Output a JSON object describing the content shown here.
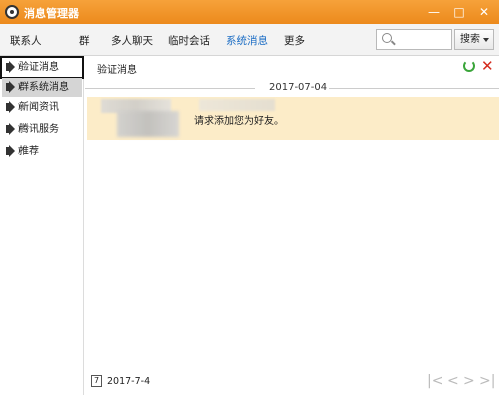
{
  "window": {
    "title": "消息管理器",
    "minimize": "—",
    "maximize": "□",
    "close": "✕"
  },
  "tabs": [
    {
      "label": "联系人"
    },
    {
      "label": "群"
    },
    {
      "label": "多人聊天"
    },
    {
      "label": "临时会话"
    },
    {
      "label": "系统消息",
      "active": true
    },
    {
      "label": "更多"
    }
  ],
  "search": {
    "placeholder": "",
    "button_label": "搜索"
  },
  "sidebar": {
    "items": [
      {
        "label": "验证消息",
        "icon": "speaker-icon"
      },
      {
        "label": "群系统消息",
        "icon": "speaker-icon"
      },
      {
        "label": "新闻资讯",
        "icon": "speaker-icon"
      },
      {
        "label": "腾讯服务",
        "icon": "speaker-icon"
      },
      {
        "label": "推荐",
        "icon": "speaker-icon"
      }
    ]
  },
  "main": {
    "header_label": "验证消息",
    "date_separator": "2017-07-04",
    "message_text": "请求添加您为好友。"
  },
  "bottom": {
    "calendar_icon_text": "7",
    "date": "2017-7-4",
    "pager": [
      "|<",
      "<",
      ">",
      ">|"
    ]
  },
  "colors": {
    "titlebar": "#ec8a1c",
    "active_tab": "#1a6cc4",
    "message_bg": "#fcecc8",
    "refresh": "#3aa53a",
    "close_red": "#d42b1e"
  }
}
